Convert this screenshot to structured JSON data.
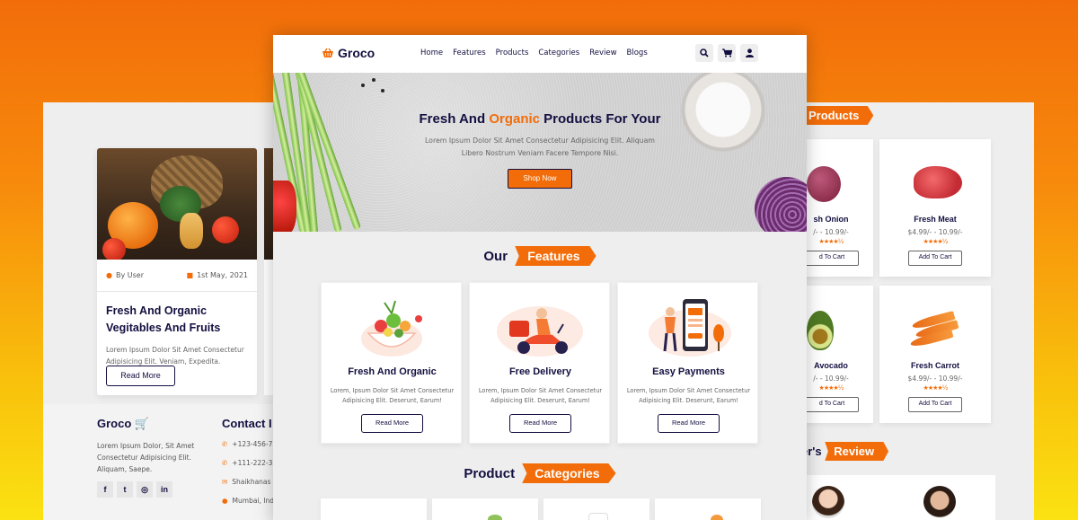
{
  "center": {
    "logo": "Groco",
    "nav": [
      "Home",
      "Features",
      "Products",
      "Categories",
      "Review",
      "Blogs"
    ],
    "icons": [
      "search-icon",
      "cart-icon",
      "user-icon"
    ],
    "hero": {
      "title_part1": "Fresh And ",
      "title_accent": "Organic",
      "title_part2": " Products For Your",
      "subtitle": "Lorem Ipsum Dolor Sit Amet Consectetur Adipisicing Elit. Aliquam Libero Nostrum Veniam Facere Tempore Nisi.",
      "button": "Shop Now"
    },
    "features": {
      "heading_plain": "Our",
      "heading_tag": "Features",
      "items": [
        {
          "title": "Fresh And Organic",
          "desc": "Lorem, Ipsum Dolor Sit Amet Consectetur Adipisicing Elit. Deserunt, Earum!",
          "button": "Read More"
        },
        {
          "title": "Free Delivery",
          "desc": "Lorem, Ipsum Dolor Sit Amet Consectetur Adipisicing Elit. Deserunt, Earum!",
          "button": "Read More"
        },
        {
          "title": "Easy Payments",
          "desc": "Lorem, Ipsum Dolor Sit Amet Consectetur Adipisicing Elit. Deserunt, Earum!",
          "button": "Read More"
        }
      ]
    },
    "categories": {
      "heading_plain": "Product",
      "heading_tag": "Categories"
    }
  },
  "left": {
    "blog": {
      "author": "By User",
      "date": "1st May, 2021",
      "title": "Fresh And Organic Vegitables And Fruits",
      "desc": "Lorem Ipsum Dolor Sit Amet Consectetur Adipisicing Elit. Veniam, Expedita.",
      "button": "Read More"
    },
    "footer": {
      "logo": "Groco",
      "desc": "Lorem Ipsum Dolor, Sit Amet Consectetur Adipisicing Elit. Aliquam, Saepe.",
      "socials": [
        "f",
        "t",
        "◎",
        "in"
      ],
      "contact_title": "Contact I",
      "contacts": [
        {
          "icon": "phone-icon",
          "text": "+123-456-78"
        },
        {
          "icon": "phone-icon",
          "text": "+111-222-333"
        },
        {
          "icon": "envelope-icon",
          "text": "Shaikhanas"
        },
        {
          "icon": "map-marker-icon",
          "text": "Mumbai, Indi"
        }
      ]
    }
  },
  "right": {
    "products_heading": "Products",
    "products": [
      {
        "name": "sh Onion",
        "price": "/- - 10.99/-",
        "stars": "★★★★½",
        "button": "d To Cart"
      },
      {
        "name": "Fresh Meat",
        "price": "$4.99/- - 10.99/-",
        "stars": "★★★★½",
        "button": "Add To Cart"
      },
      {
        "name": "Avocado",
        "price": "/- - 10.99/-",
        "stars": "★★★★½",
        "button": "d To Cart"
      },
      {
        "name": "Fresh Carrot",
        "price": "$4.99/- - 10.99/-",
        "stars": "★★★★½",
        "button": "Add To Cart"
      }
    ],
    "review_heading_plain": "er's",
    "review_heading_tag": "Review"
  },
  "colors": {
    "accent": "#f26d0a",
    "navy": "#130f40",
    "panel": "#eeeeee"
  }
}
